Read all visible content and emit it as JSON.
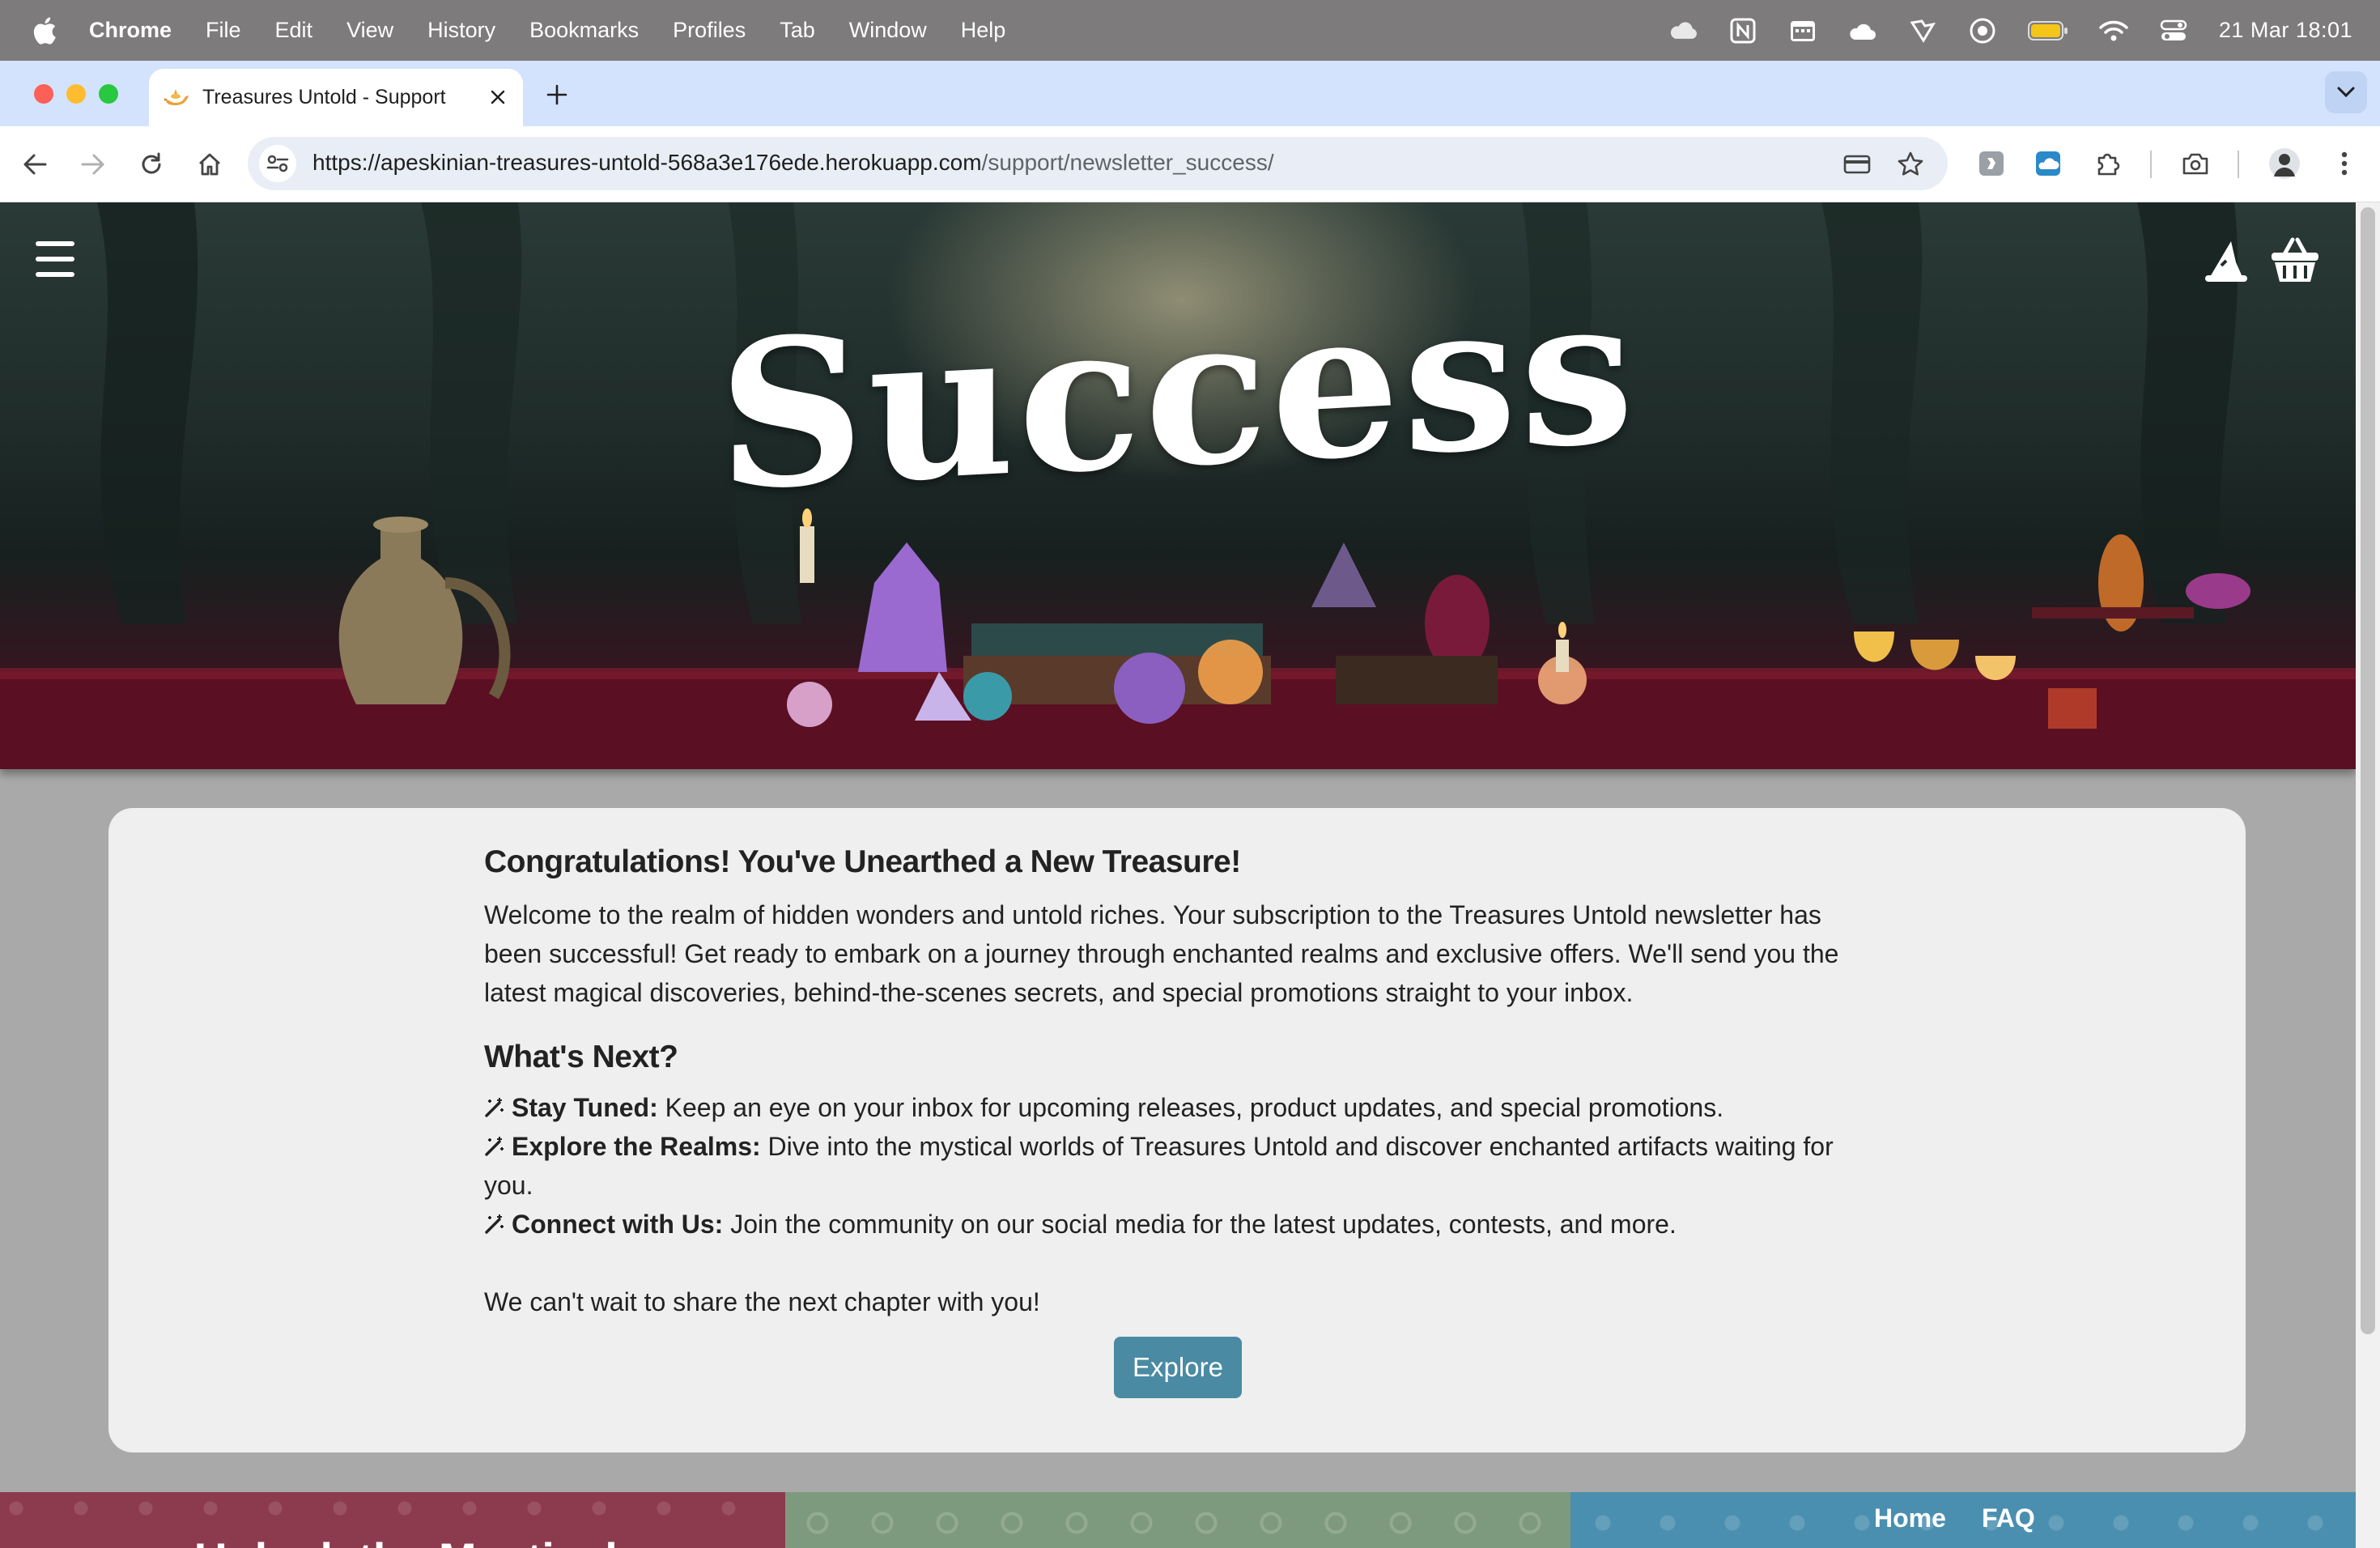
{
  "menubar": {
    "app_name": "Chrome",
    "menus": [
      "File",
      "Edit",
      "View",
      "History",
      "Bookmarks",
      "Profiles",
      "Tab",
      "Window",
      "Help"
    ],
    "clock": "21 Mar  18:01",
    "status_icons": [
      "icloud-icon",
      "notion-icon",
      "calendar-icon",
      "cloud-app-icon",
      "shield-app-icon",
      "record-icon",
      "battery-icon",
      "wifi-icon",
      "control-center-icon"
    ]
  },
  "browser": {
    "tab_title": "Treasures Untold - Support",
    "url_host": "https://apeskinian-treasures-untold-568a3e176ede.herokuapp.com",
    "url_path": "/support/newsletter_success/"
  },
  "hero": {
    "title": "Success"
  },
  "content": {
    "heading": "Congratulations! You've Unearthed a New Treasure!",
    "intro": "Welcome to the realm of hidden wonders and untold riches. Your subscription to the Treasures Untold newsletter has been successful! Get ready to embark on a journey through enchanted realms and exclusive offers. We'll send you the latest magical discoveries, behind-the-scenes secrets, and special promotions straight to your inbox.",
    "next_heading": "What's Next?",
    "items": [
      {
        "title": "Stay Tuned:",
        "text": " Keep an eye on your inbox for upcoming releases, product updates, and special promotions."
      },
      {
        "title": "Explore the Realms:",
        "text": " Dive into the mystical worlds of Treasures Untold and discover enchanted artifacts waiting for you."
      },
      {
        "title": "Connect with Us:",
        "text": " Join the community on our social media for the latest updates, contests, and more."
      }
    ],
    "closing": "We can't wait to share the next chapter with you!",
    "button_label": "Explore"
  },
  "footer": {
    "heading": "Unlock the Mystical",
    "links": [
      "Home",
      "FAQ"
    ]
  },
  "colors": {
    "accent": "#4a8aa3",
    "card_background": "#efefef",
    "page_background": "#a9a9a9",
    "footer_red": "#8c3a4d",
    "footer_green": "#7e9a7e",
    "footer_blue": "#4a8fb0"
  }
}
